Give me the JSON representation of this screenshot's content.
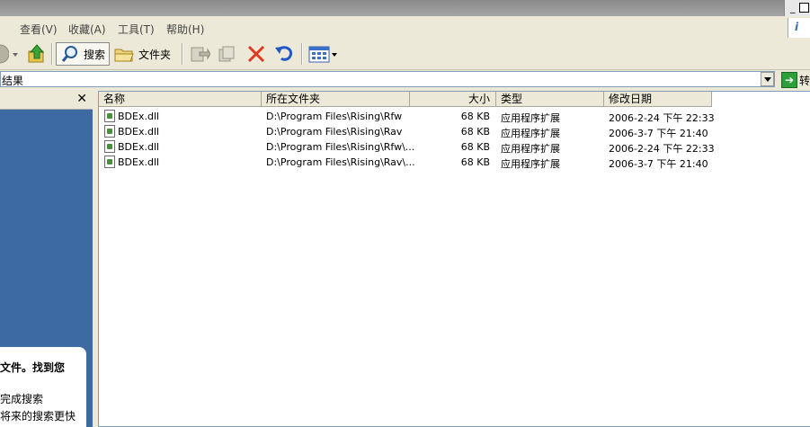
{
  "menu": {
    "view": "查看(V)",
    "favorites": "收藏(A)",
    "tools": "工具(T)",
    "help": "帮助(H)"
  },
  "toolbar": {
    "search_label": "搜索",
    "folders_label": "文件夹"
  },
  "address": {
    "value": "结果",
    "go_label": "转"
  },
  "left_pane": {
    "line1": "文件。找到您",
    "line2": "完成搜索",
    "line3": "将来的搜索更快"
  },
  "columns": {
    "name": "名称",
    "folder": "所在文件夹",
    "size": "大小",
    "type": "类型",
    "modified": "修改日期"
  },
  "rows": [
    {
      "name": "BDEx.dll",
      "folder": "D:\\Program Files\\Rising\\Rfw",
      "size": "68 KB",
      "type": "应用程序扩展",
      "modified": "2006-2-24 下午 22:33"
    },
    {
      "name": "BDEx.dll",
      "folder": "D:\\Program Files\\Rising\\Rav",
      "size": "68 KB",
      "type": "应用程序扩展",
      "modified": "2006-3-7 下午 21:40"
    },
    {
      "name": "BDEx.dll",
      "folder": "D:\\Program Files\\Rising\\Rfw\\...",
      "size": "68 KB",
      "type": "应用程序扩展",
      "modified": "2006-2-24 下午 22:33"
    },
    {
      "name": "BDEx.dll",
      "folder": "D:\\Program Files\\Rising\\Rav\\...",
      "size": "68 KB",
      "type": "应用程序扩展",
      "modified": "2006-3-7 下午 21:40"
    }
  ]
}
